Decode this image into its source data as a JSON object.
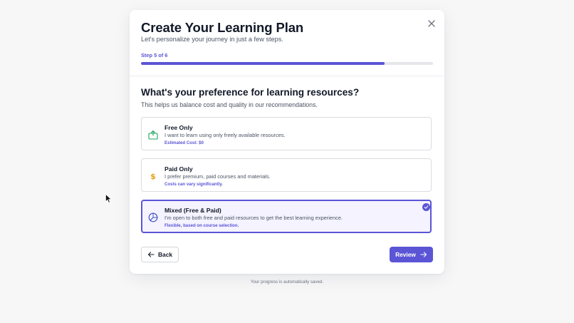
{
  "colors": {
    "accent": "#5b55d6",
    "free_icon": "#22a45d",
    "paid_icon": "#e6a117",
    "mixed_icon": "#3b4cc0"
  },
  "header": {
    "title": "Create Your Learning Plan",
    "subtitle": "Let's personalize your journey in just a few steps.",
    "close_icon": "close-icon"
  },
  "progress": {
    "label": "Step 5 of 6",
    "current_step": 5,
    "total_steps": 6,
    "fill_fraction": 0.833
  },
  "question": {
    "title": "What's your preference for learning resources?",
    "hint": "This helps us balance cost and quality in our recommendations."
  },
  "options": [
    {
      "title": "Free Only",
      "description": "I want to learn using only freely available resources.",
      "note": "Estimated Cost: $0",
      "icon": "gift-box-icon",
      "selected": false
    },
    {
      "title": "Paid Only",
      "description": "I prefer premium, paid courses and materials.",
      "note": "Costs can vary significantly.",
      "icon": "dollar-icon",
      "selected": false
    },
    {
      "title": "Mixed (Free & Paid)",
      "description": "I'm open to both free and paid resources to get the best learning experience.",
      "note": "Flexible, based on course selection.",
      "icon": "pie-chart-icon",
      "selected": true
    }
  ],
  "actions": {
    "back_label": "Back",
    "review_label": "Review"
  },
  "footer": {
    "note": "Your progress is automatically saved."
  }
}
